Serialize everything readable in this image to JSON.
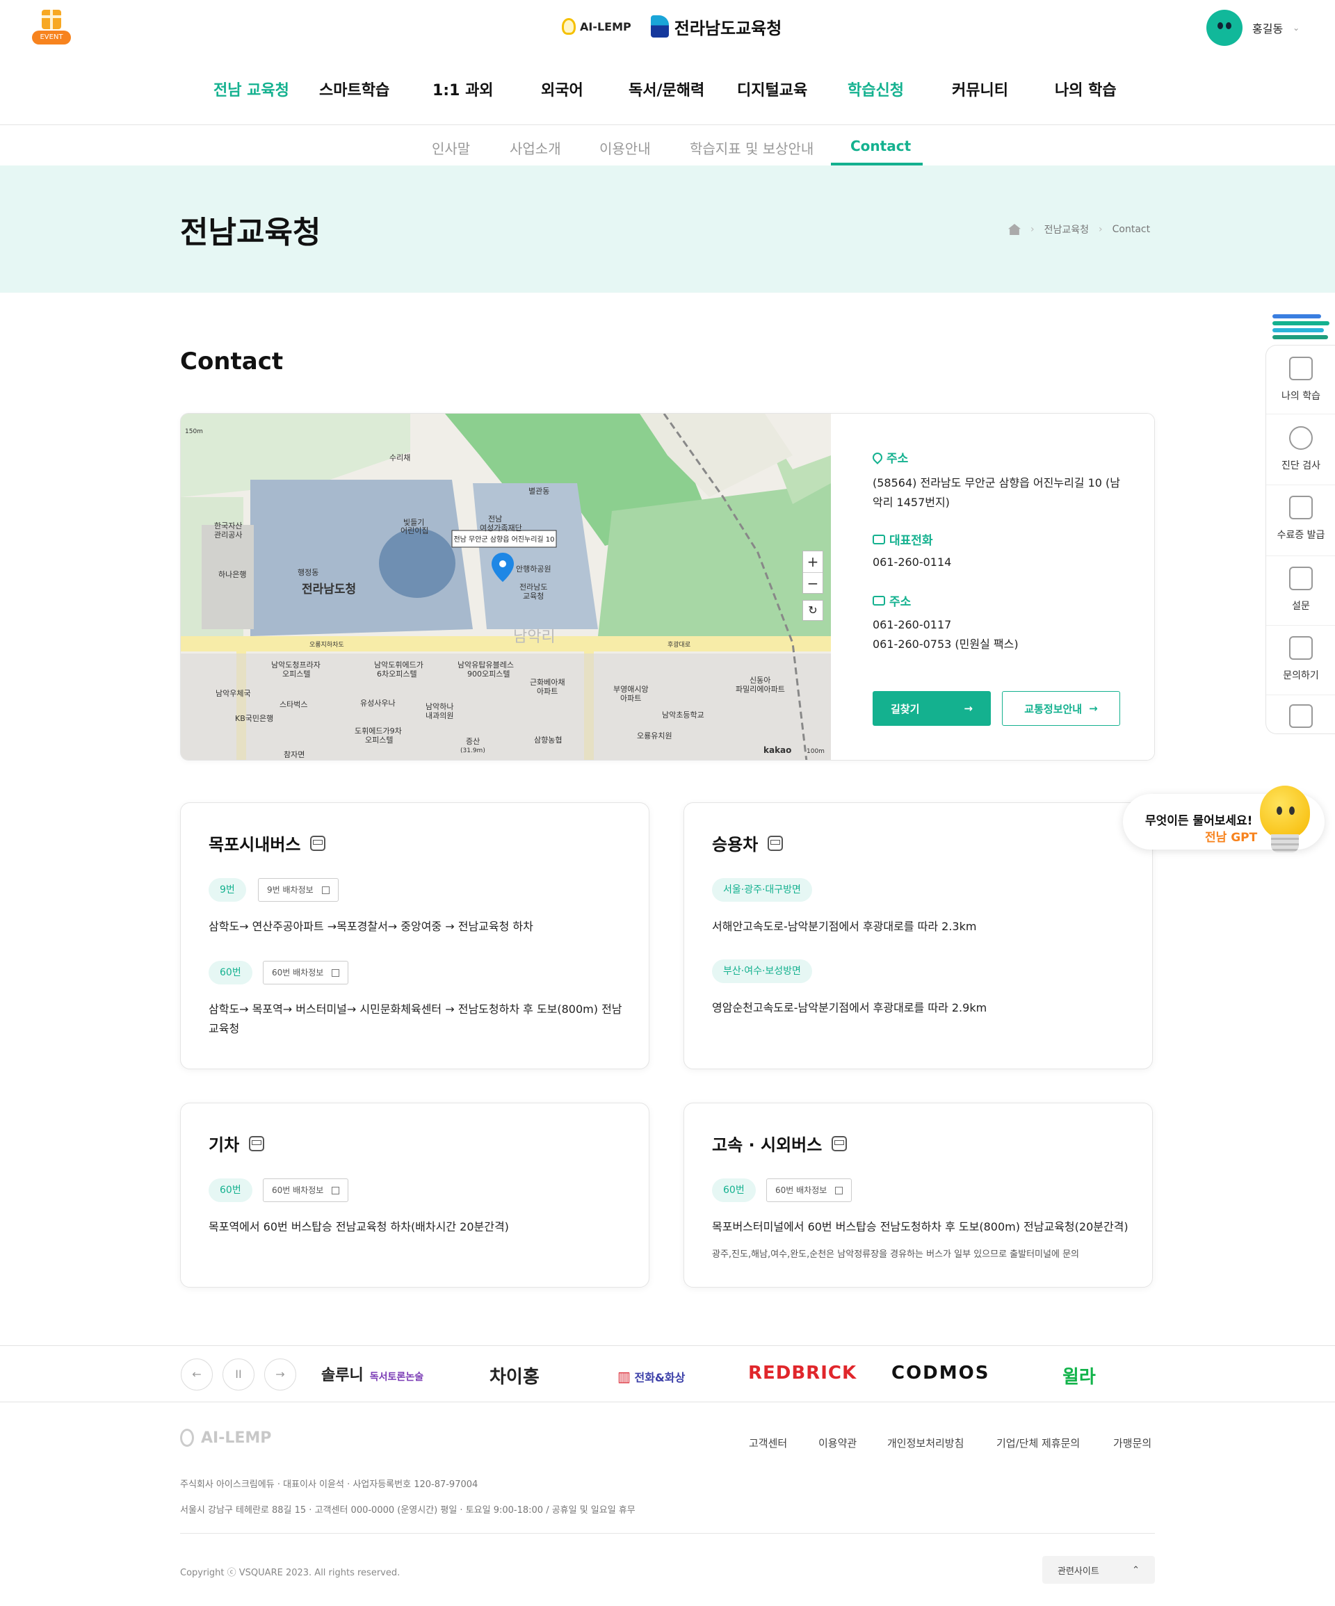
{
  "header": {
    "event_label": "EVENT",
    "service_logo": "AI-LEMP",
    "org_logo": "전라남도교육청",
    "user_name": "홍길동",
    "user_caret": "⌄"
  },
  "gnb": [
    "전남 교육청",
    "스마트학습",
    "1:1 과외",
    "외국어",
    "독서/문해력",
    "디지털교육",
    "학습신청",
    "커뮤니티",
    "나의 학습"
  ],
  "snb": [
    "인사말",
    "사업소개",
    "이용안내",
    "학습지표 및 보상안내",
    "Contact"
  ],
  "hero": {
    "title": "전남교육청",
    "breadcrumb": [
      "전남교육청",
      "Contact"
    ]
  },
  "section_title": "Contact",
  "map": {
    "scale_top": "150m",
    "scale_bottom": "100m",
    "provider": "kakao",
    "marker_label": "전남 무안군 삼향읍 어진누리길 10",
    "labels": {
      "suraechae": "수리채",
      "byeolgwandong": "별관동",
      "jeonnam_center": "전남",
      "jeonnam_center2": "여성가족재단",
      "bitdeul": "빛들기",
      "bitdeul2": "어린이집",
      "asset": "한국자산",
      "asset2": "관리공사",
      "hana": "하나은행",
      "haengjeong": "행정동",
      "dochung": "전라남도청",
      "park": "안행하공원",
      "office": "전라남도",
      "office2": "교육청",
      "namak": "남악리",
      "road1": "오룡지하차도",
      "road2": "후광대로",
      "p1": "남악도청프라자",
      "p1b": "오피스텔",
      "p2": "남악도휘에드가",
      "p2b": "6차오피스텔",
      "p3": "남악유탑유블레스",
      "p3b": "900오피스텔",
      "p4": "근화베아채",
      "p4b": "아파트",
      "p5": "부영애시앙",
      "p5b": "아파트",
      "p6": "신동아",
      "p6b": "파밀리에아파트",
      "p7": "남악초등학교",
      "p8": "오룡유치원",
      "p9": "스타벅스",
      "p10": "유성사우나",
      "p11": "KB국민은행",
      "p12": "남악우체국",
      "p13": "남악하나",
      "p13b": "내과의원",
      "p14": "도휘에드가9차",
      "p14b": "오피스텔",
      "p15": "참자면",
      "p16": "삼향농협",
      "p17": "증산",
      "p17b": "(31.9m)"
    }
  },
  "contact": {
    "address_label": "주소",
    "address": "(58564) 전라남도 무안군 삼향읍 어진누리길 10 (남악리 1457번지)",
    "phone_label": "대표전화",
    "phone": "061-260-0114",
    "fax_label": "주소",
    "fax1": "061-260-0117",
    "fax2": "061-260-0753 (민원실 팩스)",
    "find_button": "길찾기",
    "traffic_button": "교통정보안내"
  },
  "transport": {
    "bus": {
      "title": "목포시내버스",
      "r1_pill": "9번",
      "r1_sched": "9번 배차정보",
      "r1_route": "삼학도→ 연산주공아파트 →목포경찰서→ 중앙여중 → 전남교육청 하차",
      "r2_pill": "60번",
      "r2_sched": "60번 배차정보",
      "r2_route": "삼학도→ 목포역→ 버스터미널→ 시민문화체육센터 → 전남도청하차 후 도보(800m) 전남교육청"
    },
    "car": {
      "title": "승용차",
      "r1_pill": "서울·광주·대구방면",
      "r1_route": "서해안고속도로-남악분기점에서 후광대로를 따라 2.3km",
      "r2_pill": "부산·여수·보성방면",
      "r2_route": "영암순천고속도로-남악분기점에서 후광대로를 따라 2.9km"
    },
    "train": {
      "title": "기차",
      "pill": "60번",
      "sched": "60번 배차정보",
      "route": "목포역에서 60번 버스탑승 전남교육청 하차(배차시간 20분간격)"
    },
    "express": {
      "title": "고속 · 시외버스",
      "pill": "60번",
      "sched": "60번 배차정보",
      "route": "목포버스터미널에서 60번 버스탑승 전남도청하차 후 도보(800m) 전남교육청(20분간격)",
      "note": "광주,진도,해남,여수,완도,순천은 남악정류장을 경유하는 버스가 일부 있으므로 출발터미널에 문의"
    }
  },
  "quick_menu": [
    "나의 학습",
    "진단 검사",
    "수료증 발급",
    "설문",
    "문의하기"
  ],
  "gpt": {
    "line1": "무엇이든 물어보세요!",
    "line2": "전남 GPT"
  },
  "partners": {
    "prev": "←",
    "pause": "II",
    "next": "→",
    "logos": [
      "솔루니",
      "독서토론논술",
      "차이홍",
      "전화&화상",
      "REDBRICK",
      "CODMOS",
      "윌라"
    ]
  },
  "footer": {
    "logo": "AI-LEMP",
    "links": [
      "고객센터",
      "이용약관",
      "개인정보처리방침",
      "기업/단체 제휴문의",
      "가맹문의"
    ],
    "info1": "주식회사 아이스크림에듀 · 대표이사 이윤석 · 사업자등록번호 120-87-97004",
    "info2": "서울시 강남구 테헤란로 88길 15 · 고객센터 000-0000 (운영시간) 평일 · 토요일 9:00-18:00 / 공휴일 및 일요일 휴무",
    "copyright": "Copyright ⓒ VSQUARE 2023. All rights reserved.",
    "related": "관련사이트",
    "related_caret": "⌃"
  },
  "colors": {
    "accent": "#14b18f",
    "hero_bg": "#e6f7f4",
    "orange": "#f7831e"
  },
  "icons": [
    "gift-icon",
    "bulb-icon",
    "home-icon",
    "location-icon",
    "chat-icon",
    "printer-icon",
    "bus-icon",
    "car-icon",
    "train-icon",
    "arrow-right-icon",
    "external-link-icon"
  ]
}
